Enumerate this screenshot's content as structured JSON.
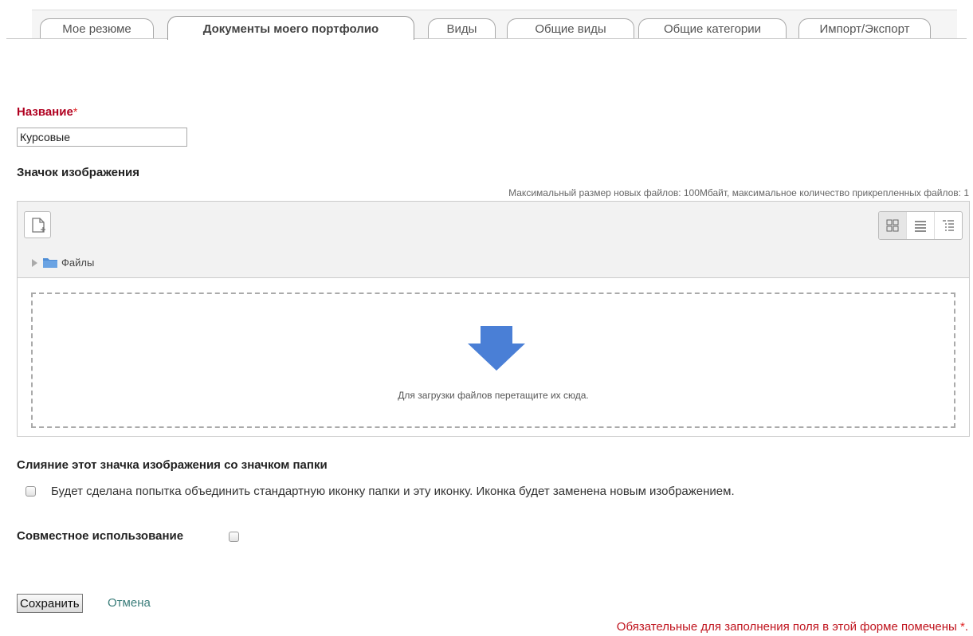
{
  "tabs": [
    {
      "label": "Мое резюме",
      "active": false
    },
    {
      "label": "Документы моего портфолио",
      "active": true
    },
    {
      "label": "Виды",
      "active": false
    },
    {
      "label": "Общие виды",
      "active": false
    },
    {
      "label": "Общие категории",
      "active": false
    },
    {
      "label": "Импорт/Экспорт",
      "active": false
    }
  ],
  "form": {
    "name_label": "Название",
    "required_star": "*",
    "name_value": "Курсовые",
    "icon_label": "Значок изображения",
    "max_size_note": "Максимальный размер новых файлов: 100Мбайт, максимальное количество прикрепленных файлов: 1",
    "filemanager": {
      "add_icon": "add-file-icon",
      "view_icons": [
        "grid-view-icon",
        "list-view-icon",
        "tree-view-icon"
      ],
      "path_label": "Файлы",
      "drop_text": "Для загрузки файлов перетащите их сюда."
    },
    "merge_label": "Слияние этот значка изображения со значком папки",
    "merge_desc": "Будет сделана попытка объединить стандартную иконку папки и эту иконку. Иконка будет заменена новым изображением.",
    "merge_checked": false,
    "share_label": "Совместное использование",
    "share_checked": false,
    "save_label": "Сохранить",
    "cancel_label": "Отмена",
    "required_note": "Обязательные для заполнения поля в этой форме помечены",
    "required_note_star": "*",
    "required_note_end": "."
  },
  "colors": {
    "required": "#b00020",
    "link": "#3a7d7a",
    "arrow": "#4a7fd6"
  }
}
